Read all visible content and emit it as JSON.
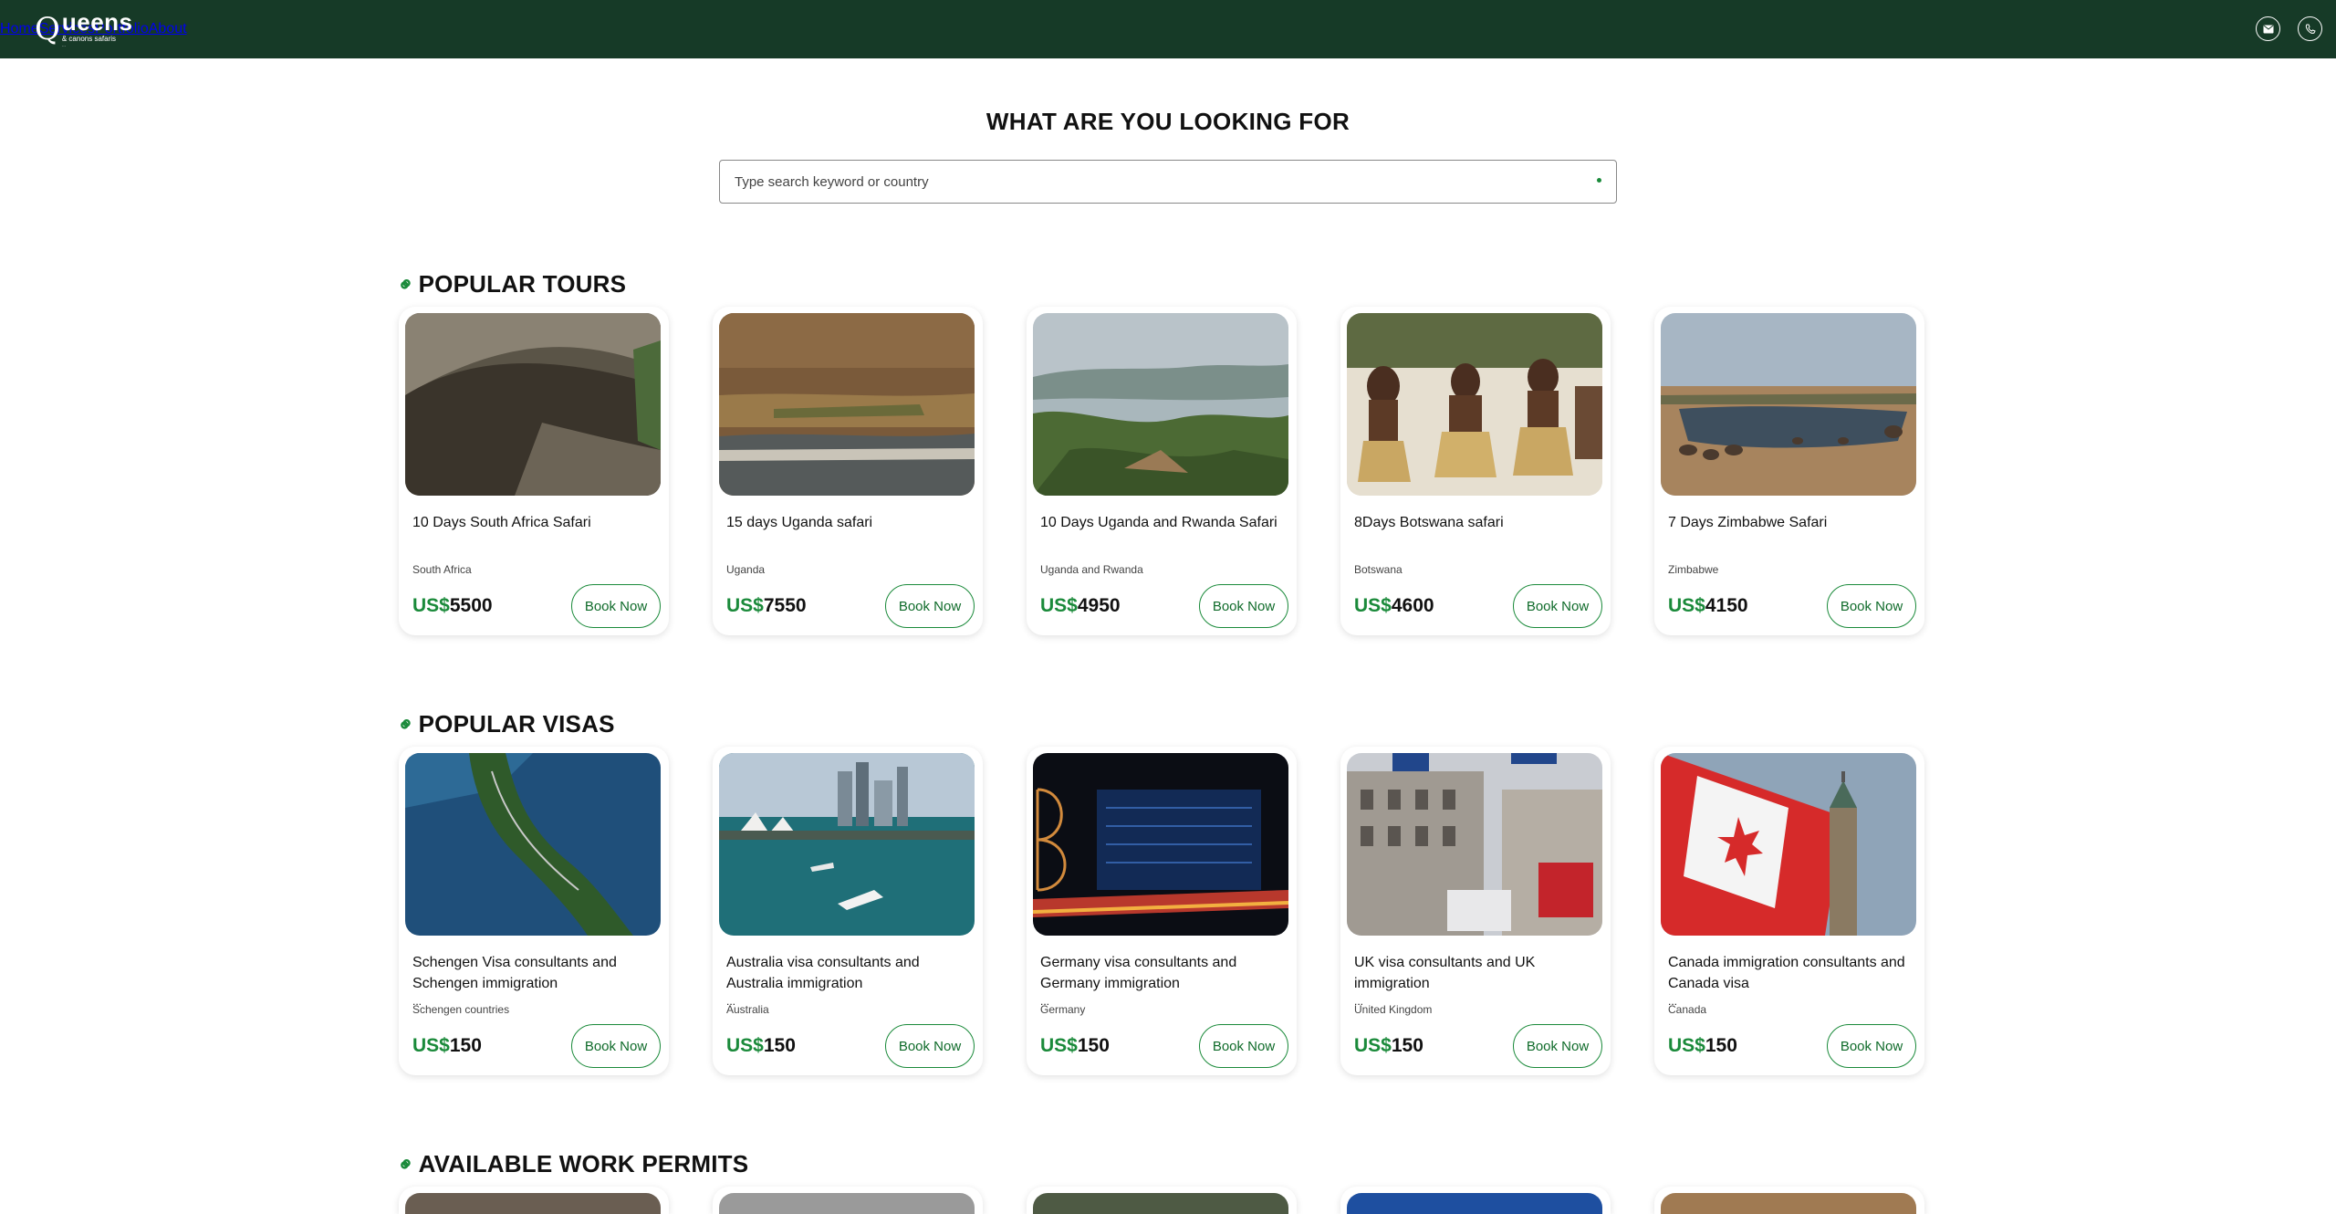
{
  "header": {
    "logo_word": "ueens",
    "logo_initial": "Q",
    "logo_sub": "& canons safaris",
    "logo_tag": "...",
    "nav": [
      {
        "label": "Home"
      },
      {
        "label": "Services"
      },
      {
        "label": "Portfolio"
      },
      {
        "label": "About"
      }
    ],
    "icons": [
      "mail-icon",
      "phone-icon"
    ]
  },
  "search": {
    "title": "WHAT ARE YOU LOOKING FOR",
    "placeholder": "Type search keyword or country"
  },
  "sections": {
    "tours": {
      "title": "POPULAR TOURS",
      "cards": [
        {
          "title": "10 Days South Africa Safari",
          "country": "South Africa",
          "currency": "US$",
          "price": "5500",
          "button": "Book Now"
        },
        {
          "title": "15 days Uganda safari",
          "country": "Uganda",
          "currency": "US$",
          "price": "7550",
          "button": "Book Now"
        },
        {
          "title": "10 Days Uganda and Rwanda Safari",
          "country": "Uganda and Rwanda",
          "currency": "US$",
          "price": "4950",
          "button": "Book Now"
        },
        {
          "title": "8Days Botswana safari",
          "country": "Botswana",
          "currency": "US$",
          "price": "4600",
          "button": "Book Now"
        },
        {
          "title": "7 Days Zimbabwe Safari",
          "country": "Zimbabwe",
          "currency": "US$",
          "price": "4150",
          "button": "Book Now"
        }
      ]
    },
    "visas": {
      "title": "POPULAR VISAS",
      "cards": [
        {
          "title": "Schengen Visa consultants and Schengen immigration",
          "dots": "...",
          "country": "Schengen countries",
          "currency": "US$",
          "price": "150",
          "button": "Book Now"
        },
        {
          "title": "Australia visa consultants and Australia immigration",
          "dots": "...",
          "country": "Australia",
          "currency": "US$",
          "price": "150",
          "button": "Book Now"
        },
        {
          "title": "Germany visa consultants and Germany immigration",
          "dots": "...",
          "country": "Germany",
          "currency": "US$",
          "price": "150",
          "button": "Book Now"
        },
        {
          "title": "UK visa consultants and UK immigration",
          "dots": "...",
          "country": "United Kingdom",
          "currency": "US$",
          "price": "150",
          "button": "Book Now"
        },
        {
          "title": "Canada immigration consultants and Canada visa",
          "dots": "...",
          "country": "Canada",
          "currency": "US$",
          "price": "150",
          "button": "Book Now"
        }
      ]
    },
    "permits": {
      "title": "AVAILABLE WORK PERMITS"
    }
  },
  "colors": {
    "header_bg": "#163a27",
    "accent": "#1a8a3a"
  }
}
